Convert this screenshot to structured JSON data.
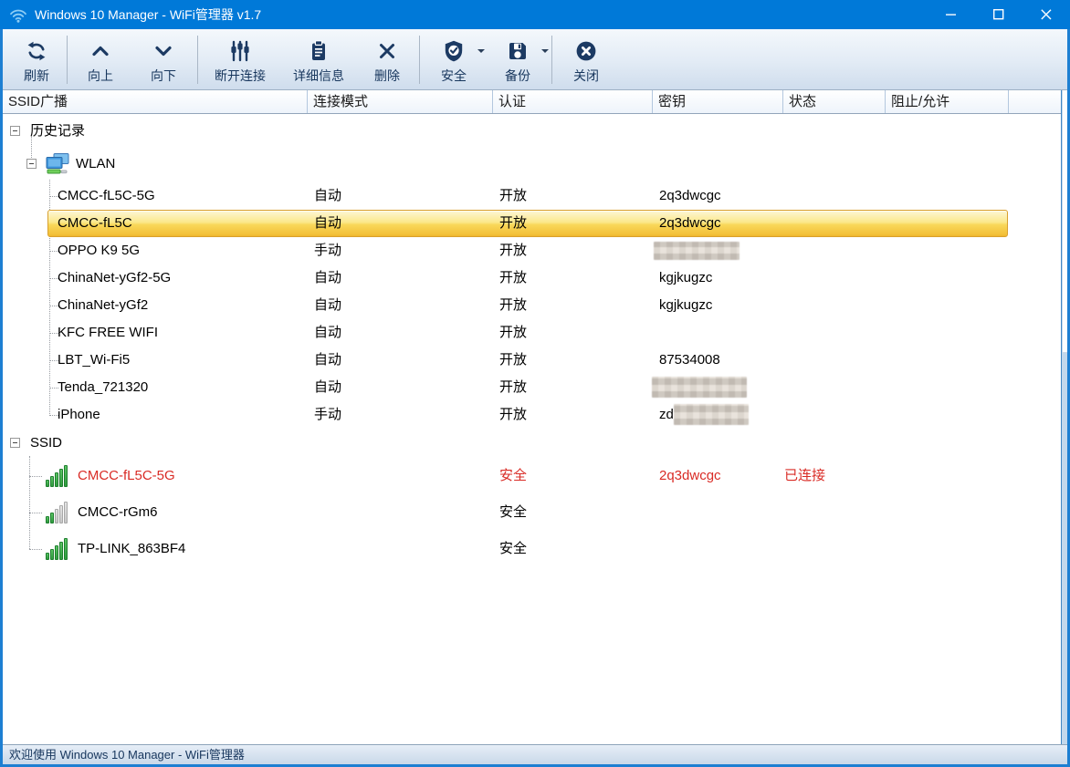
{
  "window": {
    "title": "Windows 10 Manager - WiFi管理器 v1.7"
  },
  "toolbar": {
    "buttons": [
      {
        "id": "refresh",
        "label": "刷新",
        "icon": "refresh-icon"
      },
      {
        "id": "up",
        "label": "向上",
        "icon": "chevron-up-icon"
      },
      {
        "id": "down",
        "label": "向下",
        "icon": "chevron-down-icon"
      },
      {
        "id": "disconnect",
        "label": "断开连接",
        "icon": "sliders-icon"
      },
      {
        "id": "details",
        "label": "详细信息",
        "icon": "clipboard-icon"
      },
      {
        "id": "delete",
        "label": "删除",
        "icon": "x-icon"
      },
      {
        "id": "security",
        "label": "安全",
        "icon": "shield-check-icon",
        "has_dropdown": true
      },
      {
        "id": "backup",
        "label": "备份",
        "icon": "floppy-icon",
        "has_dropdown": true
      },
      {
        "id": "close",
        "label": "关闭",
        "icon": "close-circle-icon"
      }
    ]
  },
  "table": {
    "columns": [
      "SSID广播",
      "连接模式",
      "认证",
      "密钥",
      "状态",
      "阻止/允许"
    ]
  },
  "tree": {
    "history_root": "历史记录",
    "wlan_node": "WLAN",
    "history_rows": [
      {
        "ssid": "CMCC-fL5C-5G",
        "mode": "自动",
        "auth": "开放",
        "key": "2q3dwcgc"
      },
      {
        "ssid": "CMCC-fL5C",
        "mode": "自动",
        "auth": "开放",
        "key": "2q3dwcgc",
        "selected": true
      },
      {
        "ssid": "OPPO K9 5G",
        "mode": "手动",
        "auth": "开放",
        "key": "",
        "key_censored": true
      },
      {
        "ssid": "ChinaNet-yGf2-5G",
        "mode": "自动",
        "auth": "开放",
        "key": "kgjkugzc"
      },
      {
        "ssid": "ChinaNet-yGf2",
        "mode": "自动",
        "auth": "开放",
        "key": "kgjkugzc"
      },
      {
        "ssid": "KFC FREE WIFI",
        "mode": "自动",
        "auth": "开放",
        "key": ""
      },
      {
        "ssid": "LBT_Wi-Fi5",
        "mode": "自动",
        "auth": "开放",
        "key": "87534008"
      },
      {
        "ssid": "Tenda_721320",
        "mode": "自动",
        "auth": "开放",
        "key": "",
        "key_censored": true
      },
      {
        "ssid": "iPhone",
        "mode": "手动",
        "auth": "开放",
        "key": "zd",
        "key_censored": true
      }
    ],
    "ssid_root": "SSID",
    "ssid_rows": [
      {
        "ssid": "CMCC-fL5C-5G",
        "auth": "安全",
        "key": "2q3dwcgc",
        "status": "已连接",
        "connected": true,
        "signal": 5
      },
      {
        "ssid": "CMCC-rGm6",
        "auth": "安全",
        "key": "",
        "status": "",
        "connected": false,
        "signal": 2
      },
      {
        "ssid": "TP-LINK_863BF4",
        "auth": "安全",
        "key": "",
        "status": "",
        "connected": false,
        "signal": 5
      }
    ]
  },
  "statusbar": {
    "text": "欢迎使用 Windows 10 Manager - WiFi管理器"
  },
  "colors": {
    "titlebar": "#0079d8",
    "toolbar_icon": "#1c3a63",
    "selection_border": "#d9a02d",
    "connected_red": "#d92b25",
    "signal_green": "#2f9a3e"
  }
}
